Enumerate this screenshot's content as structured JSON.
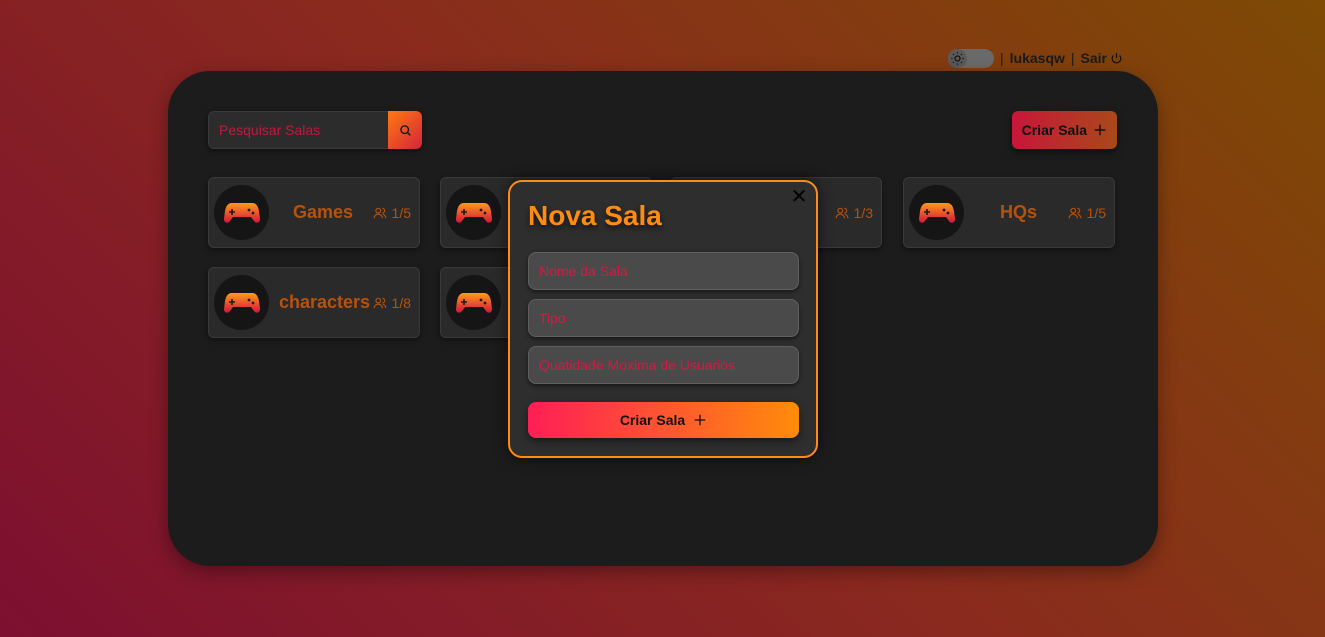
{
  "header": {
    "username": "lukasqw",
    "separator": "|",
    "logout_label": "Sair",
    "theme_icon": "sun-icon",
    "logout_icon": "power-icon"
  },
  "toolbar": {
    "search_placeholder": "Pesquisar Salas",
    "search_icon": "search-icon",
    "create_label": "Criar Sala",
    "create_icon": "plus-icon"
  },
  "rooms": [
    {
      "name": "Games",
      "count": "1/5",
      "icon": "gamepad-icon"
    },
    {
      "name": "",
      "count": "1/3",
      "icon": "gamepad-icon"
    },
    {
      "name": "HQs",
      "count": "1/5",
      "icon": "gamepad-icon"
    },
    {
      "name": "characters",
      "count": "1/8",
      "icon": "gamepad-icon"
    },
    {
      "name": "",
      "count": "",
      "icon": "gamepad-icon"
    }
  ],
  "modal": {
    "title": "Nova Sala",
    "close_icon": "close-icon",
    "name_placeholder": "Nome da Sala",
    "type_placeholder": "Tipo",
    "max_users_placeholder": "Quatidade Moxima de Usuarios",
    "submit_label": "Criar Sala"
  },
  "colors": {
    "accent_orange": "#ff8c12",
    "accent_red": "#e0204a",
    "panel_bg": "#1c1c1c",
    "card_text": "#b5520e"
  }
}
